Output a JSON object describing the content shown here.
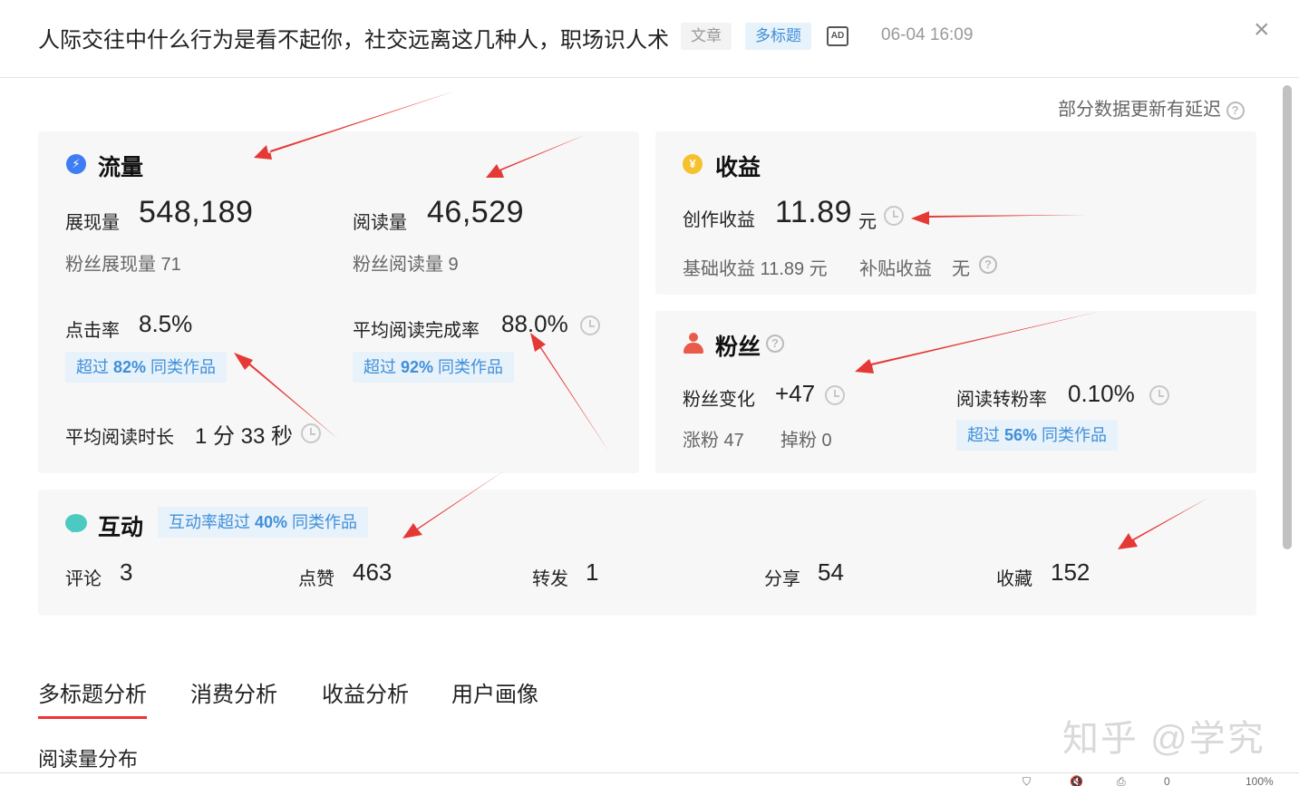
{
  "header": {
    "title": "人际交往中什么行为是看不起你，社交远离这几种人，职场识人术",
    "tag_article": "文章",
    "tag_multi": "多标题",
    "ad_icon": "AD",
    "datetime": "06-04 16:09",
    "close_icon": "×"
  },
  "delay_note": "部分数据更新有延迟",
  "help_icon": "?",
  "traffic": {
    "title": "流量",
    "impressions_label": "展现量",
    "impressions_value": "548,189",
    "reads_label": "阅读量",
    "reads_value": "46,529",
    "fan_impressions": "粉丝展现量 71",
    "fan_reads": "粉丝阅读量 9",
    "ctr_label": "点击率",
    "ctr_value": "8.5%",
    "ctr_badge_pre": "超过 ",
    "ctr_badge_pct": "82%",
    "ctr_badge_post": " 同类作品",
    "completion_label": "平均阅读完成率",
    "completion_value": "88.0%",
    "completion_badge_pre": "超过 ",
    "completion_badge_pct": "92%",
    "completion_badge_post": " 同类作品",
    "avg_time_label": "平均阅读时长",
    "avg_time_value": "1 分 33 秒"
  },
  "income": {
    "title": "收益",
    "creation_label": "创作收益",
    "creation_value": "11.89",
    "creation_unit": "元",
    "base_income": "基础收益 11.89 元",
    "subsidy_label": "补贴收益",
    "subsidy_value": "无"
  },
  "fans": {
    "title": "粉丝",
    "change_label": "粉丝变化",
    "change_value": "+47",
    "conversion_label": "阅读转粉率",
    "conversion_value": "0.10%",
    "gained": "涨粉 47",
    "lost": "掉粉 0",
    "conversion_badge_pre": "超过 ",
    "conversion_badge_pct": "56%",
    "conversion_badge_post": " 同类作品"
  },
  "interaction": {
    "title": "互动",
    "badge_pre": "互动率超过 ",
    "badge_pct": "40%",
    "badge_post": " 同类作品",
    "items": [
      {
        "label": "评论",
        "value": "3"
      },
      {
        "label": "点赞",
        "value": "463"
      },
      {
        "label": "转发",
        "value": "1"
      },
      {
        "label": "分享",
        "value": "54"
      },
      {
        "label": "收藏",
        "value": "152"
      }
    ]
  },
  "tabs": [
    "多标题分析",
    "消费分析",
    "收益分析",
    "用户画像"
  ],
  "section_heading": "阅读量分布",
  "watermark": "知乎 @学究",
  "statusbar": {
    "count": "0",
    "zoom": "100%"
  },
  "colors": {
    "accent_blue": "#3f8fd8",
    "arrow_red": "#e53935",
    "tab_underline": "#e33"
  },
  "icons": [
    "bolt-icon",
    "yuan-icon",
    "person-icon",
    "chat-icon",
    "clock-icon",
    "help-icon",
    "close-icon",
    "ad-icon"
  ]
}
